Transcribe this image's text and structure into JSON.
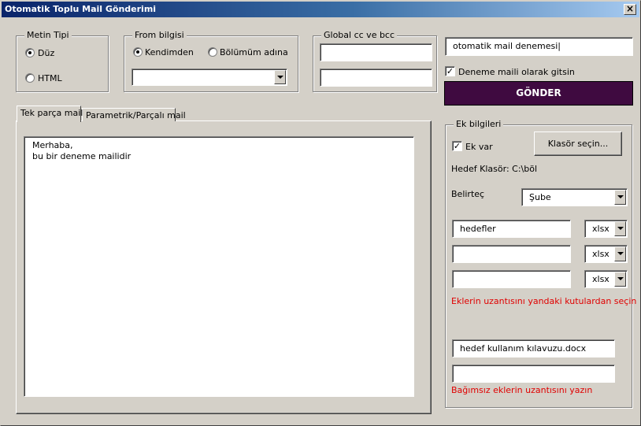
{
  "window": {
    "title": "Otomatik Toplu Mail Gönderimi",
    "close_label": "×"
  },
  "metin_tipi": {
    "legend": "Metin Tipi",
    "options": [
      {
        "label": "Düz",
        "checked": true
      },
      {
        "label": "HTML",
        "checked": false
      }
    ]
  },
  "from_bilgisi": {
    "legend": "From bilgisi",
    "options": [
      {
        "label": "Kendimden",
        "checked": true
      },
      {
        "label": "Bölümüm adına",
        "checked": false
      }
    ],
    "combo_value": ""
  },
  "global_cc": {
    "legend": "Global cc ve bcc",
    "cc_value": "",
    "bcc_value": ""
  },
  "subject": {
    "value": "otomatik mail denemesi|"
  },
  "deneme": {
    "label": "Deneme maili olarak gitsin",
    "checked": true
  },
  "send_button": {
    "label": "GÖNDER",
    "bg": "#3f0a40"
  },
  "tabs": [
    {
      "label": "Tek parça mail",
      "active": true
    },
    {
      "label": "Parametrik/Parçalı mail",
      "active": false
    }
  ],
  "body_text": {
    "line1": "Merhaba,",
    "line2": "bu bir deneme mailidir"
  },
  "ek_bilgileri": {
    "legend": "Ek bilgileri",
    "ek_var_label": "Ek var",
    "ek_var_checked": true,
    "klasor_button": "Klasör seçin...",
    "hedef_klasor": "Hedef Klasör: C:\\böl",
    "belirtec_label": "Belirteç",
    "belirtec_value": "Şube",
    "attachments": [
      {
        "name": "hedefler",
        "ext": "xlsx"
      },
      {
        "name": "",
        "ext": "xlsx"
      },
      {
        "name": "",
        "ext": "xlsx"
      }
    ],
    "ext_hint": "Eklerin uzantısını yandaki kutulardan seçin",
    "independent": [
      {
        "value": "hedef kullanım kılavuzu.docx"
      },
      {
        "value": ""
      }
    ],
    "independent_hint": "Bağımsız eklerin uzantısını yazın"
  }
}
